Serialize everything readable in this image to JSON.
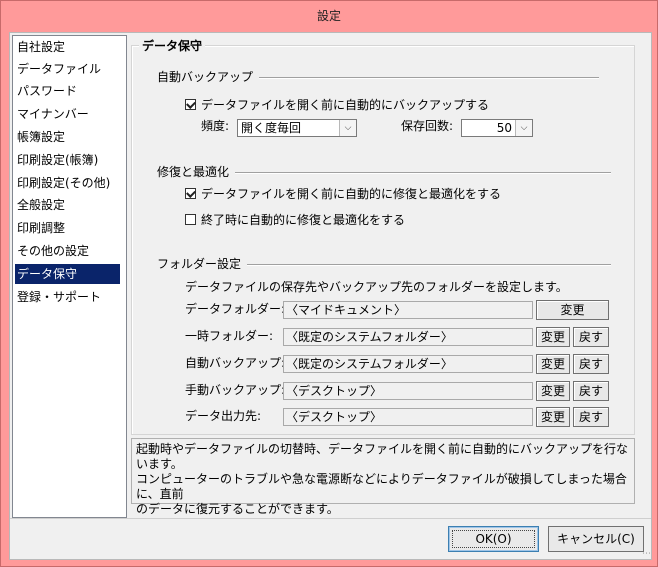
{
  "window": {
    "title": "設定"
  },
  "nav": {
    "items": [
      {
        "label": "自社設定",
        "selected": false
      },
      {
        "label": "データファイル",
        "selected": false
      },
      {
        "label": "パスワード",
        "selected": false
      },
      {
        "label": "マイナンバー",
        "selected": false
      },
      {
        "label": "帳簿設定",
        "selected": false
      },
      {
        "label": "印刷設定(帳簿)",
        "selected": false
      },
      {
        "label": "印刷設定(その他)",
        "selected": false
      },
      {
        "label": "全般設定",
        "selected": false
      },
      {
        "label": "印刷調整",
        "selected": false
      },
      {
        "label": "その他の設定",
        "selected": false
      },
      {
        "label": "データ保守",
        "selected": true
      },
      {
        "label": "登録・サポート",
        "selected": false
      }
    ]
  },
  "panel": {
    "title": "データ保守",
    "auto_backup": {
      "section_label": "自動バックアップ",
      "checkbox_label": "データファイルを開く前に自動的にバックアップする",
      "checked": true,
      "frequency_label": "頻度:",
      "frequency_value": "開く度毎回",
      "count_label": "保存回数:",
      "count_value": "50"
    },
    "repair": {
      "section_label": "修復と最適化",
      "checkbox1_label": "データファイルを開く前に自動的に修復と最適化をする",
      "checkbox1_checked": true,
      "checkbox2_label": "終了時に自動的に修復と最適化をする",
      "checkbox2_checked": false
    },
    "folders": {
      "section_label": "フォルダー設定",
      "description": "データファイルの保存先やバックアップ先のフォルダーを設定します。",
      "rows": [
        {
          "label": "データフォルダー:",
          "value": "〈マイドキュメント〉",
          "change": "変更",
          "reset": ""
        },
        {
          "label": "一時フォルダー:",
          "value": "〈既定のシステムフォルダー〉",
          "change": "変更",
          "reset": "戻す"
        },
        {
          "label": "自動バックアップ:",
          "value": "〈既定のシステムフォルダー〉",
          "change": "変更",
          "reset": "戻す"
        },
        {
          "label": "手動バックアップ:",
          "value": "〈デスクトップ〉",
          "change": "変更",
          "reset": "戻す"
        },
        {
          "label": "データ出力先:",
          "value": "〈デスクトップ〉",
          "change": "変更",
          "reset": "戻す"
        }
      ]
    }
  },
  "info": {
    "line1": "起動時やデータファイルの切替時、データファイルを開く前に自動的にバックアップを行ないます。",
    "line2": "コンピューターのトラブルや急な電源断などによりデータファイルが破損してしまった場合に、直前",
    "line3": "のデータに復元することができます。"
  },
  "buttons": {
    "ok": "OK(O)",
    "cancel": "キャンセル(C)"
  }
}
